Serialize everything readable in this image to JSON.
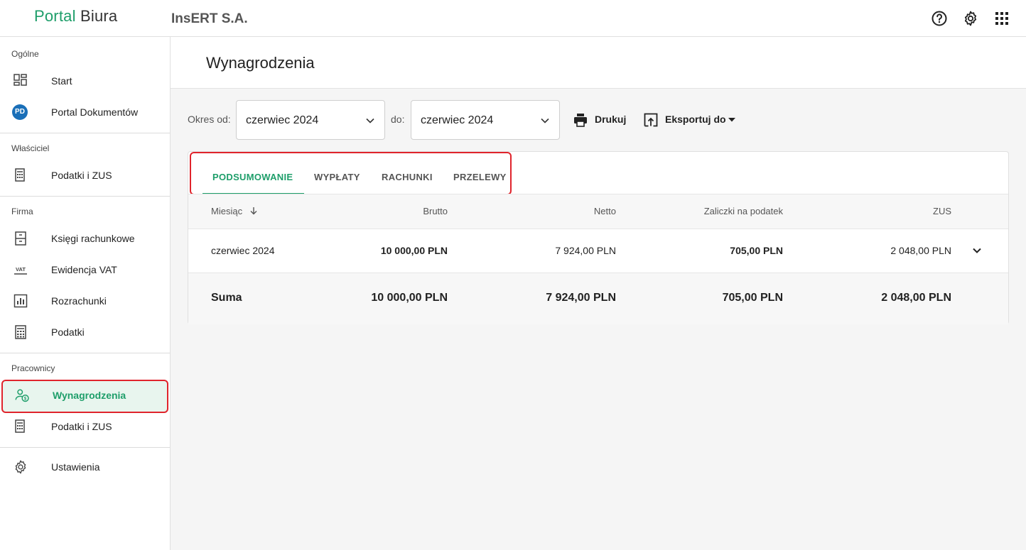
{
  "header": {
    "logo_part1": "Portal",
    "logo_part2": "Biura",
    "company": "InsERT S.A.",
    "icons": [
      "help-circle-icon",
      "gear-icon",
      "apps-grid-icon"
    ]
  },
  "sidebar": {
    "sections": [
      {
        "label": "Ogólne",
        "items": [
          {
            "label": "Start",
            "icon": "dashboard-icon"
          },
          {
            "label": "Portal Dokumentów",
            "icon": "pd-badge-icon",
            "badge": "PD"
          }
        ]
      },
      {
        "label": "Właściciel",
        "items": [
          {
            "label": "Podatki i ZUS",
            "icon": "calculator-icon"
          }
        ]
      },
      {
        "label": "Firma",
        "items": [
          {
            "label": "Księgi rachunkowe",
            "icon": "cabinet-icon"
          },
          {
            "label": "Ewidencja VAT",
            "icon": "vat-icon",
            "icon_text": "VAT"
          },
          {
            "label": "Rozrachunki",
            "icon": "chart-icon"
          },
          {
            "label": "Podatki",
            "icon": "calculator-icon"
          }
        ]
      },
      {
        "label": "Pracownicy",
        "items": [
          {
            "label": "Wynagrodzenia",
            "icon": "user-money-icon",
            "active": true
          },
          {
            "label": "Podatki i ZUS",
            "icon": "calculator-icon"
          }
        ]
      }
    ],
    "settings_label": "Ustawienia"
  },
  "page": {
    "title": "Wynagrodzenia",
    "filters": {
      "from_label": "Okres od:",
      "from_value": "czerwiec 2024",
      "to_label": "do:",
      "to_value": "czerwiec 2024"
    },
    "print_label": "Drukuj",
    "export_label": "Eksportuj do"
  },
  "tabs": [
    {
      "label": "PODSUMOWANIE",
      "active": true
    },
    {
      "label": "WYPŁATY"
    },
    {
      "label": "RACHUNKI"
    },
    {
      "label": "PRZELEWY"
    }
  ],
  "table": {
    "columns": [
      "Miesiąc",
      "Brutto",
      "Netto",
      "Zaliczki na podatek",
      "ZUS"
    ],
    "rows": [
      {
        "month": "czerwiec 2024",
        "brutto": "10 000,00 PLN",
        "netto": "7 924,00 PLN",
        "zaliczki": "705,00 PLN",
        "zus": "2 048,00 PLN"
      }
    ],
    "sum": {
      "label": "Suma",
      "brutto": "10 000,00 PLN",
      "netto": "7 924,00 PLN",
      "zaliczki": "705,00 PLN",
      "zus": "2 048,00 PLN"
    }
  },
  "colors": {
    "accent": "#1e9e6a",
    "highlight": "#e0242c",
    "badge": "#1a6fb8"
  }
}
